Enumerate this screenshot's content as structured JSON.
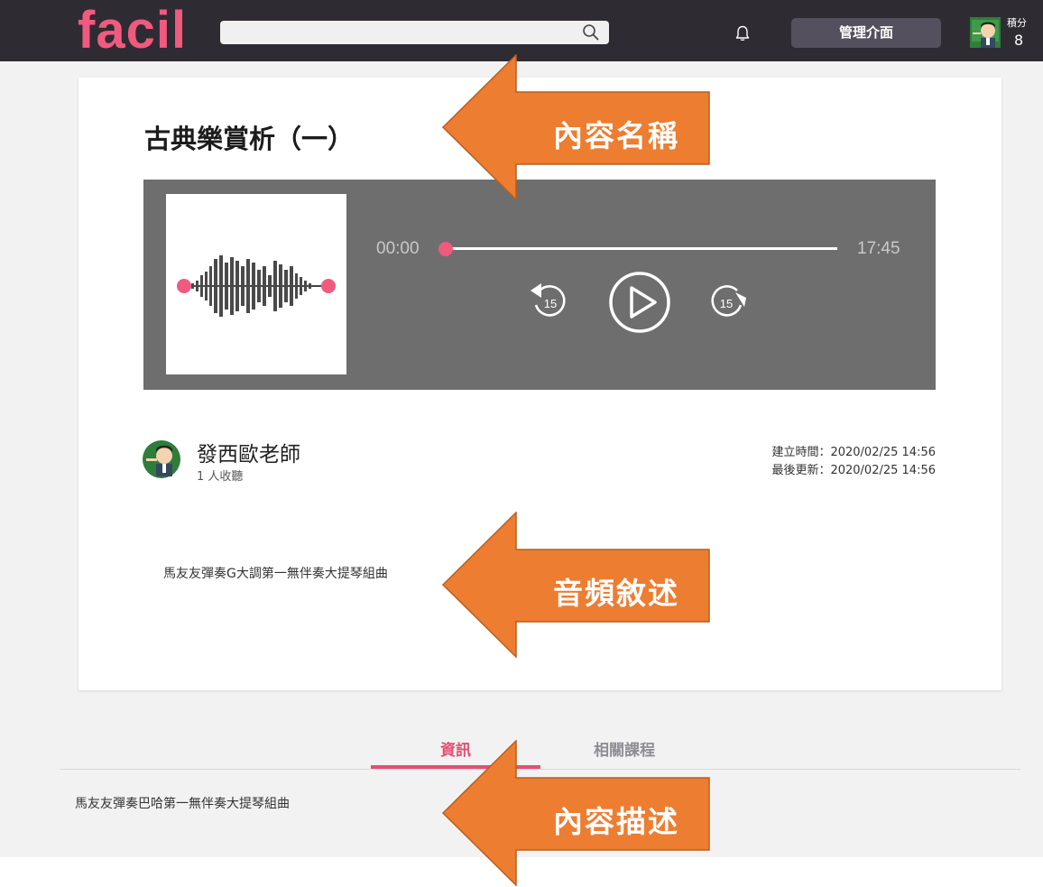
{
  "header": {
    "logo": "facil",
    "search": {
      "value": "",
      "placeholder": ""
    },
    "admin_label": "管理介面",
    "points_label": "積分",
    "points_value": "8"
  },
  "content": {
    "title": "古典樂賞析（一）",
    "player": {
      "current_time": "00:00",
      "total_time": "17:45",
      "progress": 0,
      "rewind_seconds": "15",
      "forward_seconds": "15"
    },
    "teacher": {
      "name": "發西歐老師",
      "listeners": "1 人收聽"
    },
    "created": "建立時間：2020/02/25 14:56",
    "updated": "最後更新：2020/02/25 14:56",
    "audio_description": "馬友友彈奏G大調第一無伴奏大提琴組曲"
  },
  "tabs": [
    {
      "label": "資訊",
      "active": true
    },
    {
      "label": "相關課程",
      "active": false
    }
  ],
  "content_description": "馬友友彈奏巴哈第一無伴奏大提琴組曲",
  "callouts": {
    "title": "內容名稱",
    "audio": "音頻敘述",
    "content": "內容描述"
  },
  "colors": {
    "accent": "#e34f74",
    "header_bg": "#2f2b33",
    "callout": "#ed7d31",
    "player_bg": "#6e6e6e"
  }
}
